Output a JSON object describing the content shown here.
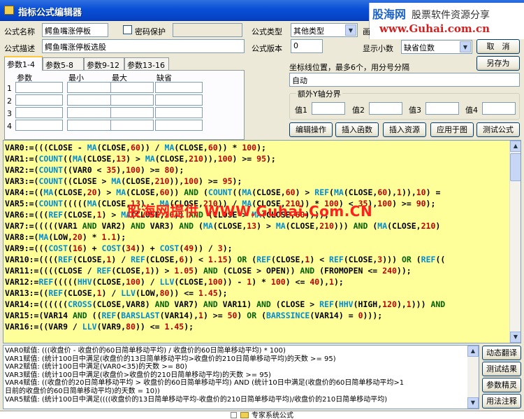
{
  "window": {
    "title": "指标公式编辑器"
  },
  "brand": {
    "name": "股海网",
    "tagline": "股票软件资源分享",
    "url": "www.Guhai.com.cn"
  },
  "form": {
    "name_label": "公式名称",
    "name_value": "鳄鱼嘴涨停板",
    "password_label": "密码保护",
    "type_label": "公式类型",
    "type_value": "其他类型",
    "draw_label": "画",
    "desc_label": "公式描述",
    "desc_value": "鳄鱼嘴涨停板选股",
    "version_label": "公式版本",
    "version_value": "0",
    "decimals_label": "显示小数",
    "decimals_value": "缺省位数"
  },
  "buttons": {
    "cancel": "取　消",
    "save_as": "另存为",
    "edit": "编辑操作",
    "insert_func": "插入函数",
    "insert_res": "插入资源",
    "apply_chart": "应用于图",
    "test": "测试公式",
    "translate": "动态翻译",
    "test_result": "测试结果",
    "param_wizard": "参数精灵",
    "usage": "用法注释"
  },
  "params": {
    "tabs": [
      "参数1-4",
      "参数5-8",
      "参数9-12",
      "参数13-16"
    ],
    "headers": [
      "参数",
      "最小",
      "最大",
      "缺省"
    ],
    "rows": [
      "1",
      "2",
      "3",
      "4"
    ]
  },
  "axis": {
    "label": "坐标线位置，最多6个，用分号分隔",
    "value": "自动",
    "extra_label": "额外Y轴分界",
    "v1": "值1",
    "v2": "值2",
    "v3": "值3",
    "v4": "值4"
  },
  "watermark": "股海网提供 WWW.Guhai.Com.CN",
  "code": [
    "VAR0:=(((CLOSE - MA(CLOSE,60)) / MA(CLOSE,60)) * 100);",
    "VAR1:=(COUNT((MA(CLOSE,13) > MA(CLOSE,210)),100) >= 95);",
    "VAR2:=(COUNT((VAR0 < 35),100) >= 80);",
    "VAR3:=(COUNT((CLOSE > MA(CLOSE,210)),100) >= 95);",
    "VAR4:=((MA(CLOSE,20) > MA(CLOSE,60)) AND (COUNT((MA(CLOSE,60) > REF(MA(CLOSE,60),1)),10) =",
    "VAR5:=(COUNT(((((MA(CLOSE,13) - MA(CLOSE,210)) / MA(CLOSE,210)) * 100) < 35),100) >= 90);",
    "VAR6:=(((REF(CLOSE,1) > MA(CLOSE,20)) AND (CLOSE > MA(CLOSE,60))));",
    "VAR7:=(((((VAR1 AND VAR2) AND VAR3) AND (MA(CLOSE,13) > MA(CLOSE,210))) AND (MA(CLOSE,210)",
    "VAR8:=(MA(LOW,20) * 1.1);",
    "VAR9:=(((COST(16) + COST(34)) + COST(49)) / 3);",
    "VAR10:=((((REF(CLOSE,1) / REF(CLOSE,6)) < 1.15) OR (REF(CLOSE,1) < REF(CLOSE,3))) OR (REF((",
    "VAR11:=((((CLOSE / REF(CLOSE,1)) > 1.05) AND (CLOSE > OPEN)) AND (FROMOPEN <= 240));",
    "VAR12:=REF(((((HHV(CLOSE,100) / LLV(CLOSE,100)) - 1) * 100) <= 40),1);",
    "VAR13:=((REF(CLOSE,1) / LLV(LOW,80)) <= 1.45);",
    "VAR14:=((((((CROSS(CLOSE,VAR8) AND VAR7) AND VAR11) AND (CLOSE > REF(HHV(HIGH,120),1))) AND",
    "VAR15:=(VAR14 AND ((REF(BARSLAST(VAR14),1) >= 50) OR (BARSSINCE(VAR14) = 0)));",
    "VAR16:=((VAR9 / LLV(VAR9,80)) <= 1.45);"
  ],
  "output": [
    "VAR0赋值: (((收盘价 - 收盘价的60日简单移动平均) / 收盘价的60日简单移动平均) * 100)",
    "VAR1赋值: (统计100日中满足(收盘价的13日简单移动平均>收盘价的210日简单移动平均)的天数 >= 95)",
    "VAR2赋值: (统计100日中满足(VAR0<35)的天数 >= 80)",
    "VAR3赋值: (统计100日中满足(收盘价>收盘价的210日简单移动平均)的天数 >= 95)",
    "VAR4赋值: ((收盘价的20日简单移动平均 > 收盘价的60日简单移动平均) AND (统计10日中满足(收盘价的60日简单移动平均>1",
    "日前的收盘价的60日简单移动平均)的天数 = 10))",
    "VAR5赋值: (统计100日中满足((((收盘价的13日简单移动平均-收盘价的210日简单移动平均)/收盘价的210日简单移动平均)"
  ],
  "bottom": {
    "label": "专家系统公式"
  }
}
